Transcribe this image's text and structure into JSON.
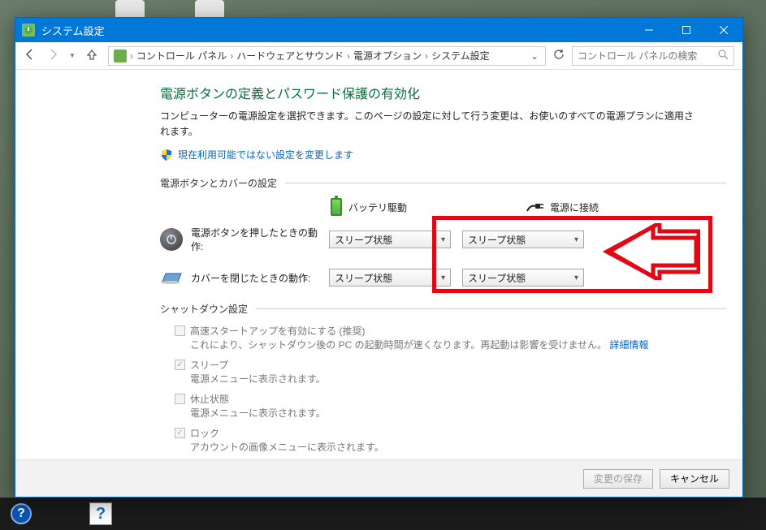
{
  "window": {
    "title": "システム設定"
  },
  "breadcrumb": {
    "items": [
      "コントロール パネル",
      "ハードウェアとサウンド",
      "電源オプション",
      "システム設定"
    ]
  },
  "search": {
    "placeholder": "コントロール パネルの検索"
  },
  "page": {
    "heading": "電源ボタンの定義とパスワード保護の有効化",
    "description": "コンピューターの電源設定を選択できます。このページの設定に対して行う変更は、お使いのすべての電源プランに適用されます。",
    "admin_link": "現在利用可能ではない設定を変更します"
  },
  "buttons_section": {
    "label": "電源ボタンとカバーの設定",
    "battery_head": "バッテリ駆動",
    "plugged_head": "電源に接続",
    "rows": [
      {
        "icon": "power",
        "label": "電源ボタンを押したときの動作:",
        "battery": "スリープ状態",
        "plugged": "スリープ状態"
      },
      {
        "icon": "lid",
        "label": "カバーを閉じたときの動作:",
        "battery": "スリープ状態",
        "plugged": "スリープ状態"
      }
    ]
  },
  "shutdown_section": {
    "label": "シャットダウン設定",
    "items": [
      {
        "label": "高速スタートアップを有効にする (推奨)",
        "checked": false,
        "enabled": false,
        "desc": "これにより、シャットダウン後の PC の起動時間が速くなります。再起動は影響を受けません。",
        "link": "詳細情報"
      },
      {
        "label": "スリープ",
        "checked": true,
        "enabled": false,
        "desc": "電源メニューに表示されます。"
      },
      {
        "label": "休止状態",
        "checked": false,
        "enabled": false,
        "desc": "電源メニューに表示されます。"
      },
      {
        "label": "ロック",
        "checked": true,
        "enabled": false,
        "desc": "アカウントの画像メニューに表示されます。"
      }
    ]
  },
  "footer": {
    "save": "変更の保存",
    "cancel": "キャンセル"
  }
}
